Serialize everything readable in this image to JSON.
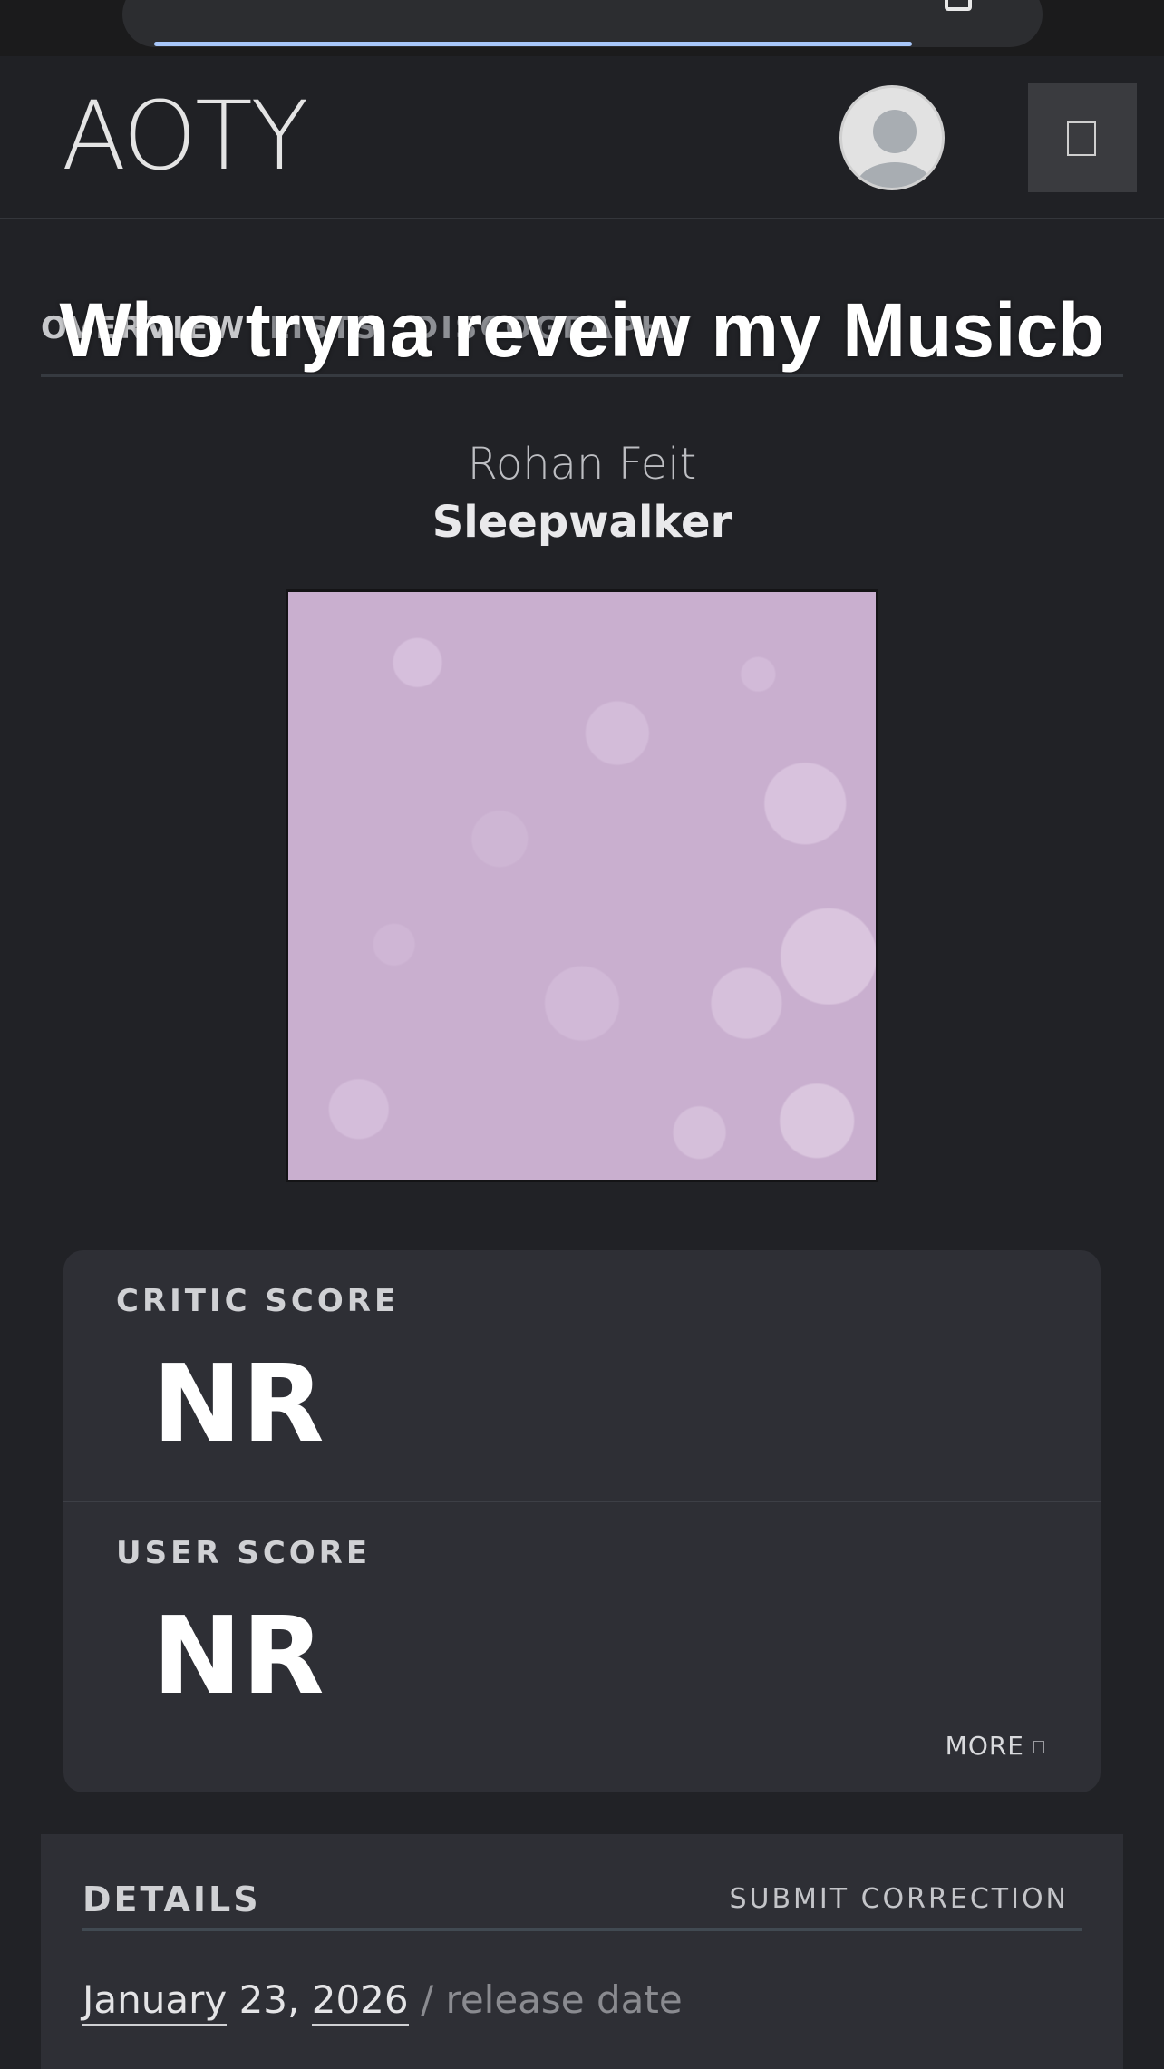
{
  "header": {
    "logo": "AOTY"
  },
  "subnav": {
    "tabs": [
      "OVERVIEW",
      "LISTS",
      "DISCOGRAPHY"
    ]
  },
  "caption": "Who tryna reveiw my Musicb",
  "album": {
    "artist": "Rohan Feit",
    "title": "Sleepwalker"
  },
  "scores": {
    "critic_label": "CRITIC SCORE",
    "critic_value": "NR",
    "user_label": "USER SCORE",
    "user_value": "NR",
    "more_label": "MORE"
  },
  "details": {
    "title": "DETAILS",
    "submit_correction": "SUBMIT CORRECTION",
    "release_month": "January",
    "release_day": " 23, ",
    "release_year": "2026",
    "release_suffix": " / release date"
  },
  "colors": {
    "background": "#212226",
    "card": "#2e2f35",
    "cover": "#c9afcf"
  }
}
